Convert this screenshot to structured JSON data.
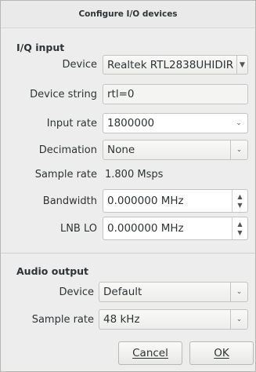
{
  "window": {
    "title": "Configure I/O devices"
  },
  "iq_input": {
    "title": "I/Q input",
    "device_label": "Device",
    "device_value": "Realtek RTL2838UHIDIR",
    "device_string_label": "Device string",
    "device_string_value": "rtl=0",
    "input_rate_label": "Input rate",
    "input_rate_value": "1800000",
    "decimation_label": "Decimation",
    "decimation_value": "None",
    "sample_rate_label": "Sample rate",
    "sample_rate_value": "1.800 Msps",
    "bandwidth_label": "Bandwidth",
    "bandwidth_value": "0.000000 MHz",
    "lnb_lo_label": "LNB LO",
    "lnb_lo_value": "0.000000 MHz"
  },
  "audio_output": {
    "title": "Audio output",
    "device_label": "Device",
    "device_value": "Default",
    "sample_rate_label": "Sample rate",
    "sample_rate_value": "48 kHz"
  },
  "buttons": {
    "cancel": "Cancel",
    "ok": "OK"
  },
  "icons": {
    "dropdown": "chevron-down-icon",
    "spin_up": "arrow-up-icon",
    "spin_down": "arrow-down-icon"
  }
}
